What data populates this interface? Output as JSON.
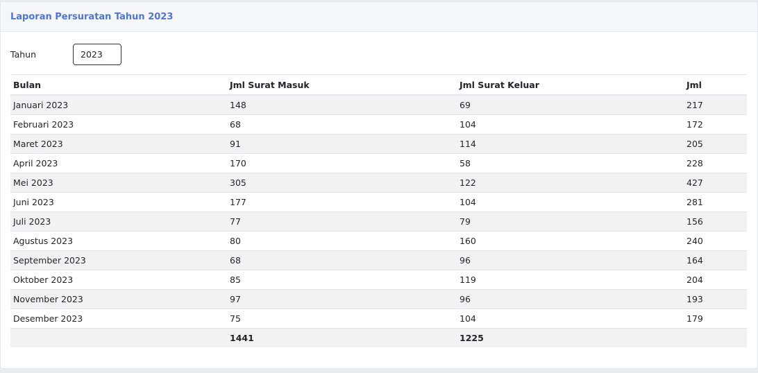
{
  "header": {
    "title": "Laporan Persuratan Tahun 2023"
  },
  "filter": {
    "label": "Tahun",
    "value": "2023"
  },
  "table": {
    "columns": [
      "Bulan",
      "Jml Surat Masuk",
      "Jml Surat Keluar",
      "Jml"
    ],
    "rows": [
      [
        "Januari 2023",
        "148",
        "69",
        "217"
      ],
      [
        "Februari 2023",
        "68",
        "104",
        "172"
      ],
      [
        "Maret 2023",
        "91",
        "114",
        "205"
      ],
      [
        "April 2023",
        "170",
        "58",
        "228"
      ],
      [
        "Mei 2023",
        "305",
        "122",
        "427"
      ],
      [
        "Juni 2023",
        "177",
        "104",
        "281"
      ],
      [
        "Juli 2023",
        "77",
        "79",
        "156"
      ],
      [
        "Agustus 2023",
        "80",
        "160",
        "240"
      ],
      [
        "September 2023",
        "68",
        "96",
        "164"
      ],
      [
        "Oktober 2023",
        "85",
        "119",
        "204"
      ],
      [
        "November 2023",
        "97",
        "96",
        "193"
      ],
      [
        "Desember 2023",
        "75",
        "104",
        "179"
      ]
    ],
    "totals": [
      "",
      "1441",
      "1225",
      ""
    ]
  },
  "colors": {
    "accent": "#4e73df",
    "stripe": "#f2f2f2",
    "header_bg": "#f6f7fb"
  }
}
